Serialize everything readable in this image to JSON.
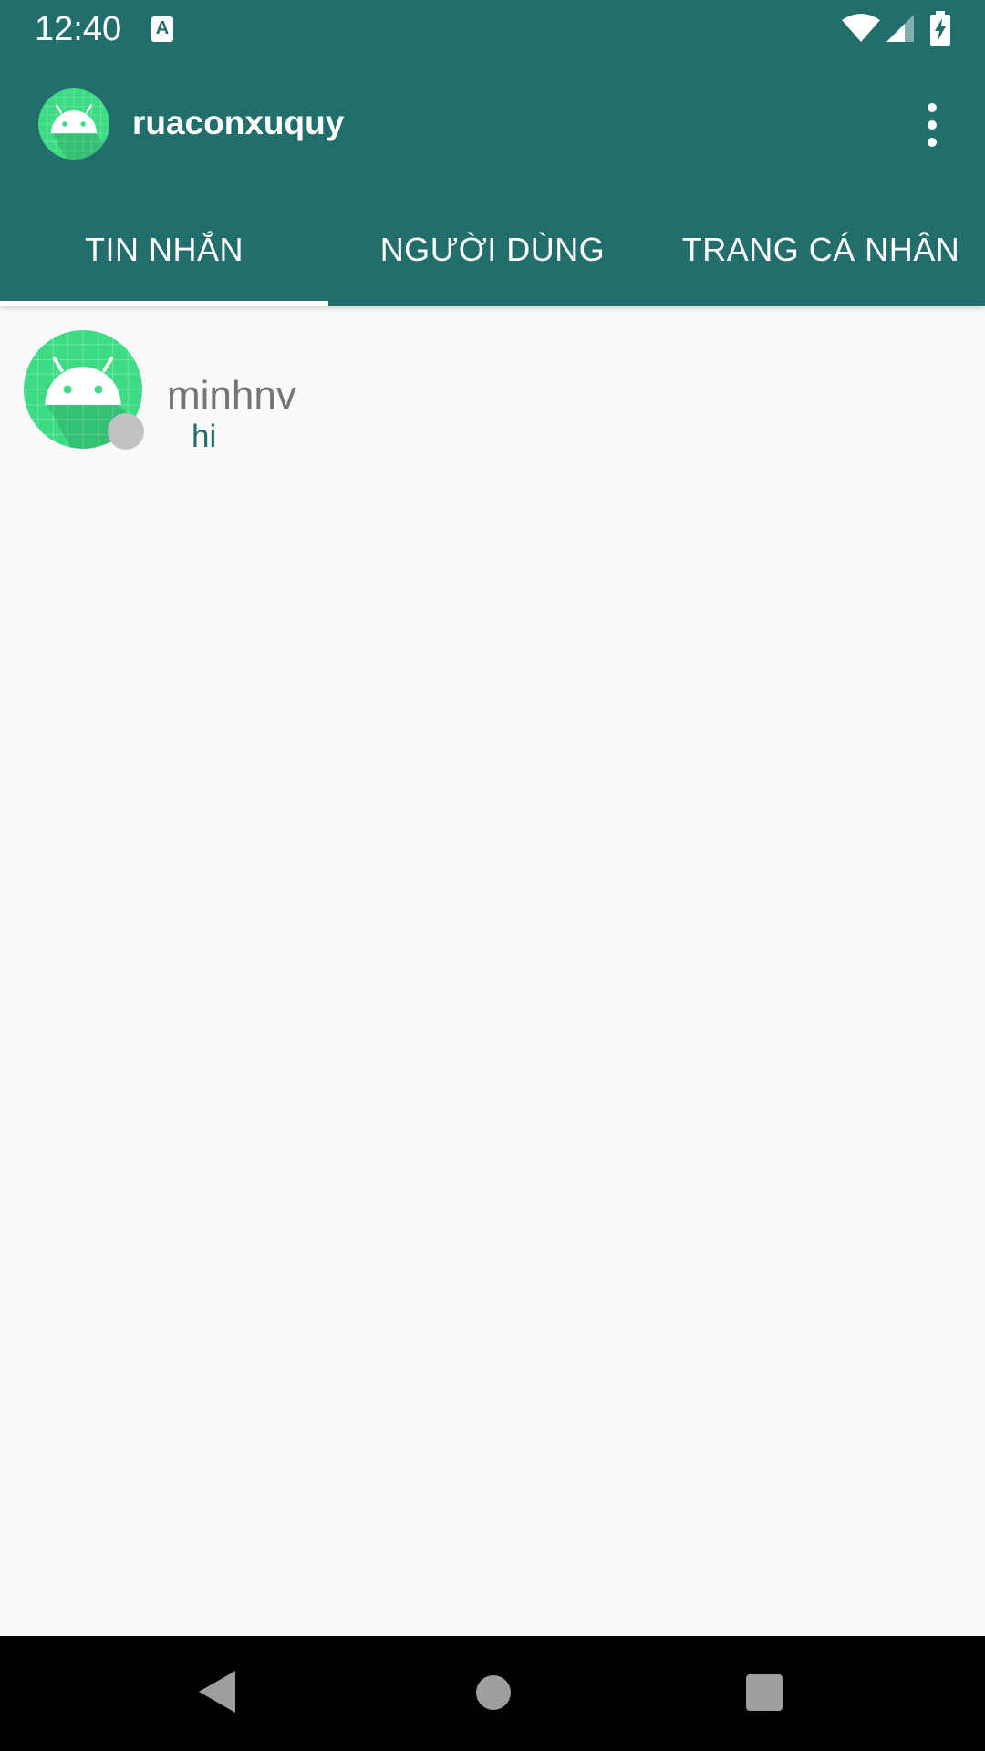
{
  "status_bar": {
    "time": "12:40",
    "notification_icon_letter": "A",
    "icons": [
      "a-notification-icon",
      "wifi-icon",
      "signal-icon",
      "battery-charging-icon"
    ]
  },
  "app_bar": {
    "title": "ruaconxuquy",
    "avatar_icon": "android-avatar-icon",
    "menu_icon": "overflow-menu-icon"
  },
  "tabs": [
    {
      "label": "TIN NHẮN",
      "selected": true
    },
    {
      "label": "NGƯỜI DÙNG",
      "selected": false
    },
    {
      "label": "TRANG CÁ NHÂN",
      "selected": false
    }
  ],
  "chats": [
    {
      "name": "minhnv",
      "last_message": "hi",
      "online": false
    }
  ],
  "nav_bar": {
    "buttons": [
      "back-icon",
      "home-icon",
      "recents-icon"
    ]
  },
  "colors": {
    "primary": "#226e6c",
    "background": "#fafafa",
    "avatar_green": "#3ddc84",
    "offline_dot": "#c2c2c2"
  }
}
